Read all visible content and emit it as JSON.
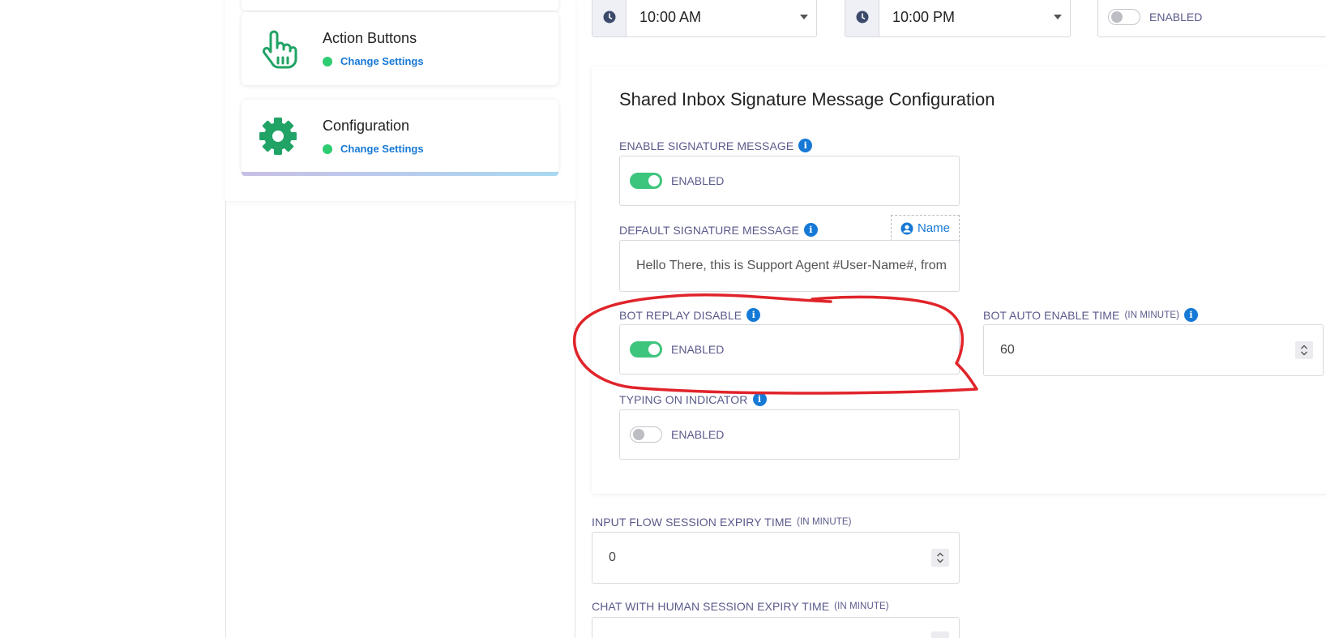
{
  "sidebar": {
    "cards": [
      {
        "title": "Action Buttons",
        "link": "Change Settings",
        "icon": "pointing-hand-icon"
      },
      {
        "title": "Configuration",
        "link": "Change Settings",
        "icon": "gear-icon"
      }
    ]
  },
  "top_row": {
    "start_time": "10:00 AM",
    "end_time": "10:00 PM",
    "toggle_label": "ENABLED",
    "toggle_on": false
  },
  "signature_panel": {
    "title": "Shared Inbox Signature Message Configuration",
    "enable_signature": {
      "label": "ENABLE SIGNATURE MESSAGE",
      "toggle_label": "ENABLED",
      "on": true
    },
    "default_signature": {
      "label": "DEFAULT SIGNATURE MESSAGE",
      "tag_label": "Name",
      "value": "Hello There, this is Support Agent #User-Name#, from"
    },
    "bot_replay_disable": {
      "label": "BOT REPLAY DISABLE",
      "toggle_label": "ENABLED",
      "on": true
    },
    "bot_auto_enable_time": {
      "label": "BOT AUTO ENABLE TIME",
      "unit": "(IN MINUTE)",
      "value": "60"
    },
    "typing_indicator": {
      "label": "TYPING ON INDICATOR",
      "toggle_label": "ENABLED",
      "on": false
    }
  },
  "input_flow_expiry": {
    "label": "INPUT FLOW SESSION EXPIRY TIME",
    "unit": "(IN MINUTE)",
    "value": "0"
  },
  "chat_human_expiry": {
    "label": "CHAT WITH HUMAN SESSION EXPIRY TIME",
    "unit": "(IN MINUTE)",
    "value": ""
  },
  "colors": {
    "accent": "#1779d6",
    "toggle_on": "#3ec57d",
    "label": "#5a5a8c",
    "annotation": "#e0242a"
  }
}
